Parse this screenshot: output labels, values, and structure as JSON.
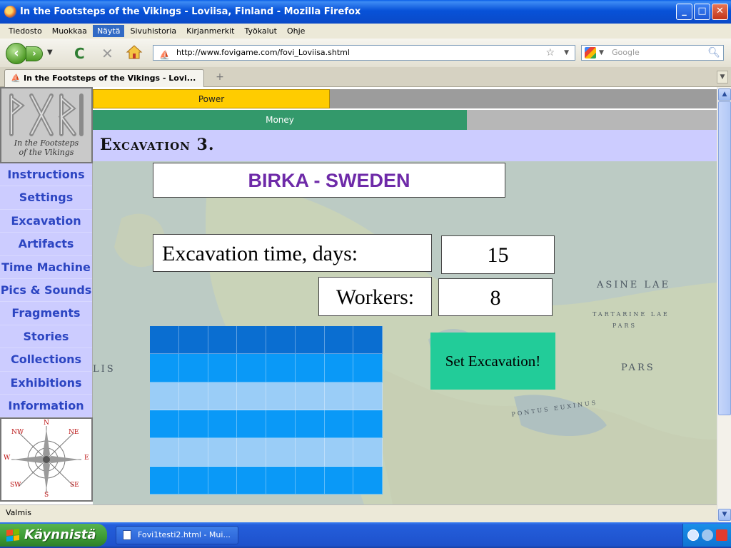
{
  "window": {
    "title": "In the Footsteps of the Vikings - Loviisa, Finland - Mozilla Firefox",
    "minimize_icon": "minimize-icon",
    "maximize_icon": "maximize-icon",
    "close_icon": "close-icon"
  },
  "menu": {
    "items": [
      "Tiedosto",
      "Muokkaa",
      "Näytä",
      "Sivuhistoria",
      "Kirjanmerkit",
      "Työkalut",
      "Ohje"
    ],
    "active_index": 2
  },
  "nav": {
    "url": "http://www.fovigame.com/fovi_Loviisa.shtml",
    "search_placeholder": "Google"
  },
  "tabs": [
    {
      "label": "In the Footsteps of the Vikings - Lovi..."
    }
  ],
  "site": {
    "logo_text_line1": "In the Footsteps",
    "logo_text_line2": "of the Vikings",
    "power_label": "Power",
    "power_level_fraction": 0.38,
    "money_label": "Money",
    "money_level_fraction": 0.6,
    "page_heading": "Excavation 3.",
    "sidebar": [
      "Instructions",
      "Settings",
      "Excavation",
      "Artifacts",
      "Time Machine",
      "Pics & Sounds",
      "Fragments",
      "Stories",
      "Collections",
      "Exhibitions",
      "Information"
    ],
    "compass": {
      "n": "N",
      "ne": "NE",
      "e": "E",
      "se": "SE",
      "s": "S",
      "sw": "SW",
      "w": "W",
      "nw": "NW"
    },
    "location": "BIRKA - SWEDEN",
    "time_label": "Excavation time, days:",
    "time_value": "15",
    "workers_label": "Workers:",
    "workers_value": "8",
    "set_button": "Set Excavation!",
    "grid": {
      "cols": 8,
      "row_colors": [
        "#0A6ED1",
        "#0A99F7",
        "#9ACDF7",
        "#0A99F7",
        "#9ACDF7",
        "#0A99F7"
      ]
    },
    "map_labels": [
      "ASINE LAE",
      "TARTARINE LAE",
      "PARS",
      "PARS",
      "PONTUS EUXINUS",
      "LIS"
    ],
    "colors": {
      "power": "#FFCC00",
      "money": "#33996B",
      "band": "#CCCCFF",
      "button": "#22CC99",
      "location_text": "#6E2AA8"
    }
  },
  "status": {
    "text": "Valmis"
  },
  "taskbar": {
    "start_label": "Käynnistä",
    "task_label": "Fovi1testi2.html - Mui..."
  }
}
